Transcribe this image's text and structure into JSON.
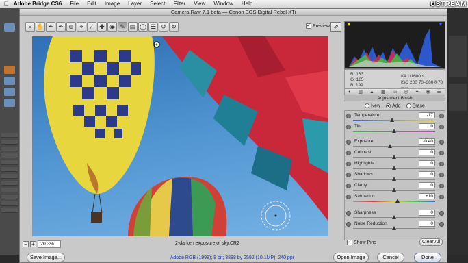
{
  "menubar": {
    "app_name": "Adobe Bridge CS6",
    "items": [
      "File",
      "Edit",
      "Image",
      "Layer",
      "Select",
      "Filter",
      "View",
      "Window",
      "Help"
    ],
    "watermark": "USTREAM"
  },
  "dialog": {
    "title": "Camera Raw 7.1 beta  —  Canon EOS Digital Rebel XTi"
  },
  "toolbar": {
    "tools": [
      "zoom-icon",
      "hand-icon",
      "white-balance-icon",
      "color-sampler-icon",
      "target-adjust-icon",
      "crop-icon",
      "straighten-icon",
      "spot-removal-icon",
      "red-eye-icon",
      "adjustment-brush-icon",
      "graduated-filter-icon",
      "radial-filter-icon",
      "preferences-icon",
      "rotate-left-icon",
      "rotate-right-icon"
    ],
    "preview_label": "Preview",
    "preview_checked": true
  },
  "status": {
    "zoom": "20.3%",
    "filename": "2-darken exposure of sky.CR2"
  },
  "readout": {
    "r": "R:   133",
    "g": "G:   165",
    "b": "B:   199",
    "exposure": "f/4    1/1600 s",
    "iso": "ISO 200   70–300@70 mm"
  },
  "panel": {
    "title": "Adjustment Brush",
    "modes": [
      "New",
      "Add",
      "Erase"
    ],
    "selected_mode": "Add",
    "sliders": [
      {
        "label": "Temperature",
        "value": "-17"
      },
      {
        "label": "Tint",
        "value": "0"
      },
      {
        "label": "Exposure",
        "value": "-0.40"
      },
      {
        "label": "Contrast",
        "value": "0"
      },
      {
        "label": "Highlights",
        "value": "0"
      },
      {
        "label": "Shadows",
        "value": "0"
      },
      {
        "label": "Clarity",
        "value": "0"
      },
      {
        "label": "Saturation",
        "value": "+10"
      },
      {
        "label": "Sharpness",
        "value": "0"
      },
      {
        "label": "Noise Reduction",
        "value": "0"
      }
    ],
    "show_pins_label": "Show Pins",
    "show_pins_checked": true,
    "clear_all_label": "Clear All"
  },
  "footer": {
    "save_image": "Save Image...",
    "workflow": "Adobe RGB (1998); 8 bit; 3888 by 2592 (10.1MP); 240 ppi",
    "open_image": "Open Image",
    "cancel": "Cancel",
    "done": "Done"
  }
}
